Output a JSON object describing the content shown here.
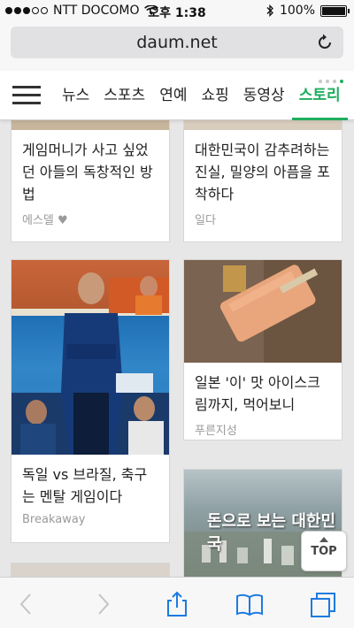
{
  "status": {
    "carrier": "NTT DOCOMO",
    "time": "오후 1:38",
    "battery": "100%",
    "battery_level": 1.0
  },
  "browser": {
    "url": "daum.net"
  },
  "nav": {
    "tabs": [
      "뉴스",
      "스포츠",
      "연예",
      "쇼핑",
      "동영상",
      "스토리"
    ],
    "active_tab": "스토리",
    "accent_color": "#1fae5e"
  },
  "cards": [
    {
      "title": "게임머니가 사고 싶었던 아들의 독창적인 방법",
      "source": "에스델 ♥"
    },
    {
      "title": "대한민국이 감추려하는 진실, 밀양의 아픔을 포착하다",
      "source": "일다"
    },
    {
      "title": "독일 vs 브라질, 축구는 멘탈 게임이다",
      "source": "Breakaway"
    },
    {
      "title": "일본 '이' 맛 아이스크림까지, 먹어보니",
      "source": "푸른지성"
    },
    {
      "title": "돈으로 보는 대한민국",
      "source": ""
    }
  ],
  "top_button": {
    "label": "TOP"
  }
}
